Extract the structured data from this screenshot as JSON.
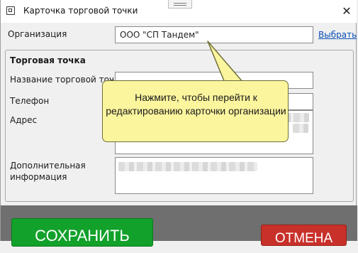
{
  "window": {
    "title": "Карточка торговой точки",
    "close_glyph": "✕"
  },
  "organization": {
    "label": "Организация",
    "value": "ООО \"СП Тандем\"",
    "select_link": "Выбрать"
  },
  "group": {
    "title": "Торговая точка",
    "fields": {
      "name_label": "Название торговой точки",
      "phone_label": "Телефон",
      "address_label": "Адрес",
      "additional_label": "Дополнительная\nинформация"
    }
  },
  "tooltip": {
    "text": "Нажмите, чтобы перейти к редактированию карточки организации",
    "background": "#fbf59e"
  },
  "buttons": {
    "save": "СОХРАНИТЬ",
    "cancel": "ОТМЕНА",
    "save_color": "#12a12a",
    "cancel_color": "#c8302a"
  }
}
